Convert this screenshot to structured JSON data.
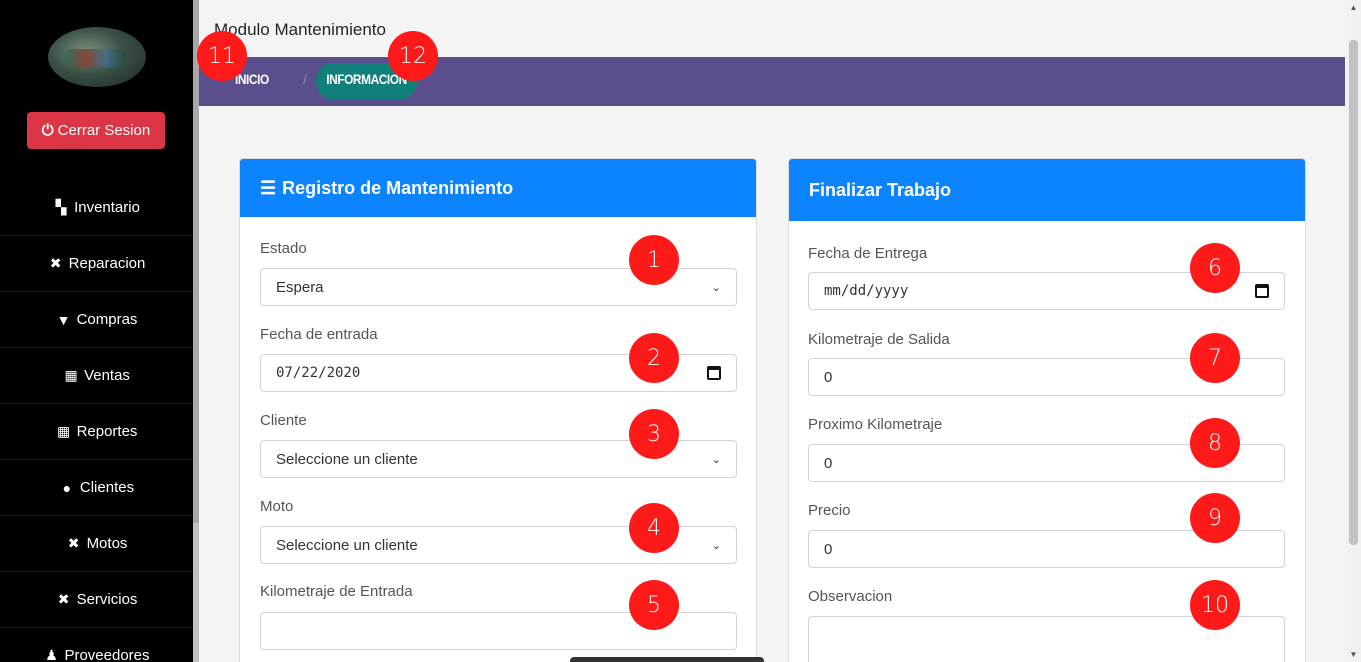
{
  "sidebar": {
    "logout_label": "Cerrar Sesion",
    "items": [
      {
        "label": "Inventario",
        "icon": "boxes-icon"
      },
      {
        "label": "Reparacion",
        "icon": "tools-icon"
      },
      {
        "label": "Compras",
        "icon": "cart-icon"
      },
      {
        "label": "Ventas",
        "icon": "cash-register-icon"
      },
      {
        "label": "Reportes",
        "icon": "cash-register-icon"
      },
      {
        "label": "Clientes",
        "icon": "users-icon"
      },
      {
        "label": "Motos",
        "icon": "tools-icon"
      },
      {
        "label": "Servicios",
        "icon": "tools-icon"
      },
      {
        "label": "Proveedores",
        "icon": "user-tie-icon"
      }
    ]
  },
  "header": {
    "title": "Modulo Mantenimiento",
    "breadcrumb": [
      "INICIO",
      "INFORMACION"
    ],
    "separator": "/"
  },
  "registro": {
    "title": "Registro de Mantenimiento",
    "estado_label": "Estado",
    "estado_value": "Espera",
    "fecha_entrada_label": "Fecha de entrada",
    "fecha_entrada_value": "07/22/2020",
    "cliente_label": "Cliente",
    "cliente_value": "Seleccione un cliente",
    "moto_label": "Moto",
    "moto_value": "Seleccione un cliente",
    "km_entrada_label": "Kilometraje de Entrada",
    "km_entrada_value": ""
  },
  "finalizar": {
    "title": "Finalizar Trabajo",
    "fecha_entrega_label": "Fecha de Entrega",
    "fecha_entrega_placeholder": "mm/dd/yyyy",
    "km_salida_label": "Kilometraje de Salida",
    "km_salida_value": "0",
    "proximo_km_label": "Proximo Kilometraje",
    "proximo_km_value": "0",
    "precio_label": "Precio",
    "precio_value": "0",
    "observacion_label": "Observacion",
    "observacion_value": ""
  },
  "badges": [
    "1",
    "2",
    "3",
    "4",
    "5",
    "6",
    "7",
    "8",
    "9",
    "10",
    "11",
    "12"
  ],
  "colors": {
    "sidebar_bg": "#000000",
    "logout_red": "#dc3545",
    "breadcrumb_bg": "#5a4f8c",
    "breadcrumb_active": "#11807a",
    "card_header": "#0d84ff",
    "badge_red": "#ff1a1a"
  }
}
